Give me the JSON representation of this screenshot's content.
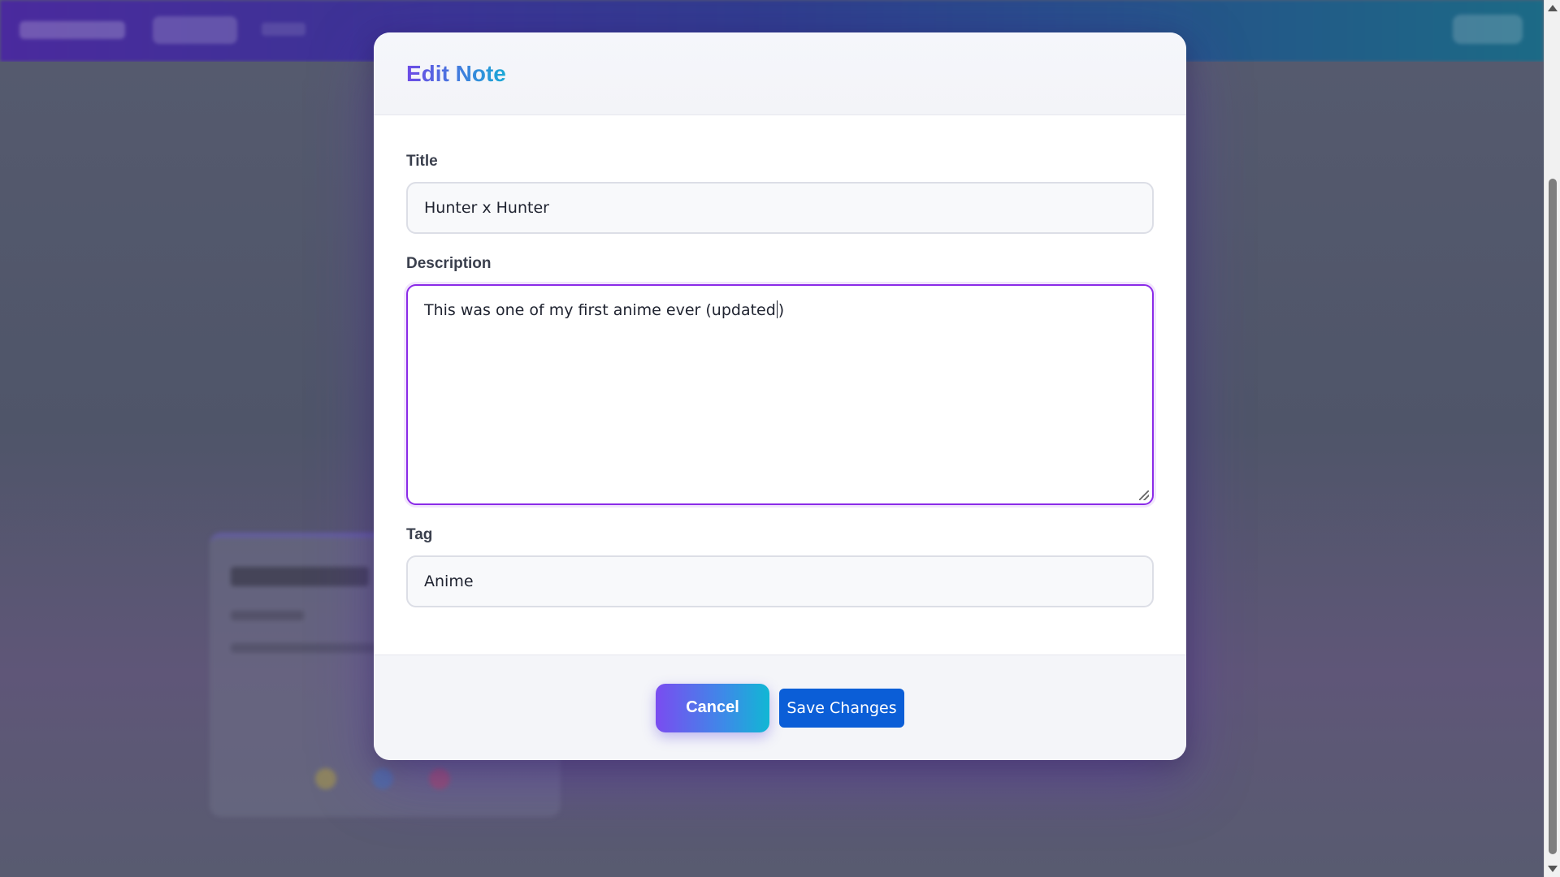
{
  "modal": {
    "title": "Edit Note",
    "fields": {
      "title_label": "Title",
      "title_value": "Hunter x Hunter",
      "description_label": "Description",
      "description_before_caret": "This was one of my first anime ever (updated",
      "description_after_caret": ")",
      "tag_label": "Tag",
      "tag_value": "Anime"
    },
    "buttons": {
      "cancel": "Cancel",
      "save": "Save Changes"
    }
  },
  "colors": {
    "accent_purple": "#8b2be8",
    "save_blue": "#0b5ed7",
    "title_gradient_start": "#6d4ae6",
    "title_gradient_end": "#1aa9d6"
  }
}
